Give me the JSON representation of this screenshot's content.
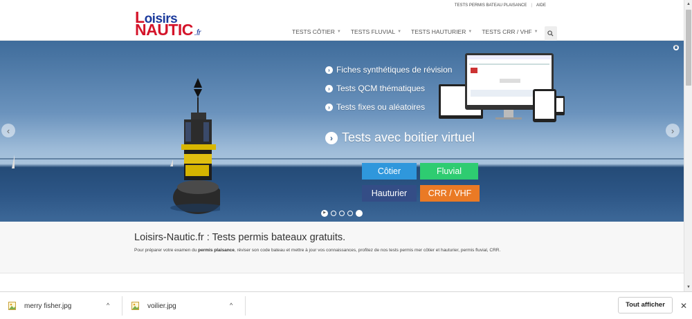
{
  "header": {
    "logo_line1": "oisirs",
    "logo_L": "L",
    "logo_line2": "NAUTIC",
    "logo_fr": ".fr",
    "top_links": [
      "TESTS PERMIS BATEAU PLAISANCE",
      "AIDE"
    ],
    "nav": [
      "TESTS CÔTIER",
      "TESTS FLUVIAL",
      "TESTS HAUTURIER",
      "TESTS CRR / VHF"
    ]
  },
  "hero": {
    "features": [
      "Fiches synthétiques de révision",
      "Tests QCM thématiques",
      "Tests fixes ou aléatoires"
    ],
    "big_feature": "Tests avec boitier virtuel",
    "buttons": {
      "cotier": "Côtier",
      "fluvial": "Fluvial",
      "hauturier": "Hauturier",
      "crr": "CRR / VHF"
    },
    "colors": {
      "cotier": "#2f97dc",
      "fluvial": "#2ecc71",
      "hauturier": "#344d86",
      "crr": "#ea7a25"
    }
  },
  "content": {
    "title": "Loisirs-Nautic.fr : Tests permis bateaux gratuits.",
    "text_before": "Pour préparer votre examen du ",
    "text_bold": "permis plaisance",
    "text_after": ", réviser son code bateau et mettre à jour vos connaissances, profitez de nos tests permis mer côtier et hauturier, permis fluvial, CRR."
  },
  "downloads": {
    "items": [
      "merry fisher.jpg",
      "voilier.jpg"
    ],
    "show_all": "Tout afficher"
  }
}
